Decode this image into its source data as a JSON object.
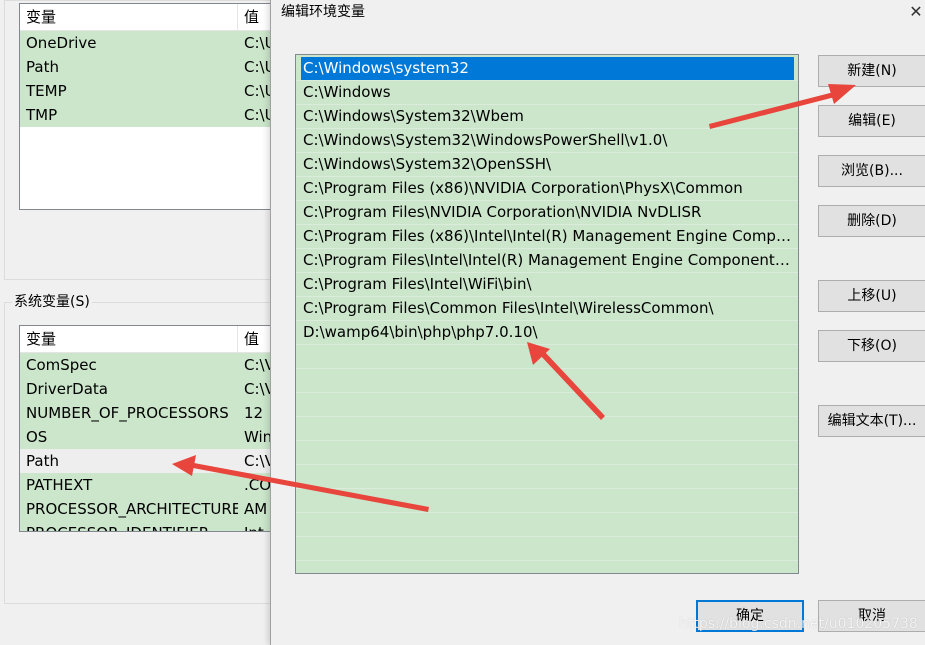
{
  "user_vars": {
    "header": {
      "name": "变量",
      "value": "值"
    },
    "rows": [
      {
        "name": "OneDrive",
        "value": "C:\\U"
      },
      {
        "name": "Path",
        "value": "C:\\U"
      },
      {
        "name": "TEMP",
        "value": "C:\\U"
      },
      {
        "name": "TMP",
        "value": "C:\\U"
      }
    ]
  },
  "system_vars": {
    "group_label": "系统变量(S)",
    "header": {
      "name": "变量",
      "value": "值"
    },
    "rows": [
      {
        "name": "ComSpec",
        "value": "C:\\V"
      },
      {
        "name": "DriverData",
        "value": "C:\\V"
      },
      {
        "name": "NUMBER_OF_PROCESSORS",
        "value": "12"
      },
      {
        "name": "OS",
        "value": "Win"
      },
      {
        "name": "Path",
        "value": "C:\\V"
      },
      {
        "name": "PATHEXT",
        "value": ".CO"
      },
      {
        "name": "PROCESSOR_ARCHITECTURE",
        "value": "AM"
      },
      {
        "name": "PROCESSOR_IDENTIFIER",
        "value": "Int"
      }
    ]
  },
  "dialog": {
    "title": "编辑环境变量",
    "close": "✕",
    "paths": [
      "C:\\Windows\\system32",
      "C:\\Windows",
      "C:\\Windows\\System32\\Wbem",
      "C:\\Windows\\System32\\WindowsPowerShell\\v1.0\\",
      "C:\\Windows\\System32\\OpenSSH\\",
      "C:\\Program Files (x86)\\NVIDIA Corporation\\PhysX\\Common",
      "C:\\Program Files\\NVIDIA Corporation\\NVIDIA NvDLISR",
      "C:\\Program Files (x86)\\Intel\\Intel(R) Management Engine Compon...",
      "C:\\Program Files\\Intel\\Intel(R) Management Engine Components\\...",
      "C:\\Program Files\\Intel\\WiFi\\bin\\",
      "C:\\Program Files\\Common Files\\Intel\\WirelessCommon\\",
      "D:\\wamp64\\bin\\php\\php7.0.10\\"
    ],
    "buttons": {
      "new": "新建(N)",
      "edit": "编辑(E)",
      "browse": "浏览(B)...",
      "delete": "删除(D)",
      "move_up": "上移(U)",
      "move_down": "下移(O)",
      "edit_text": "编辑文本(T)...",
      "ok": "确定",
      "cancel": "取消"
    },
    "watermark": "https://blog.csdn.net/u010205738"
  },
  "colors": {
    "list_bg": "#cbe6cb",
    "selection": "#0078d7",
    "arrow": "#e8453c"
  }
}
